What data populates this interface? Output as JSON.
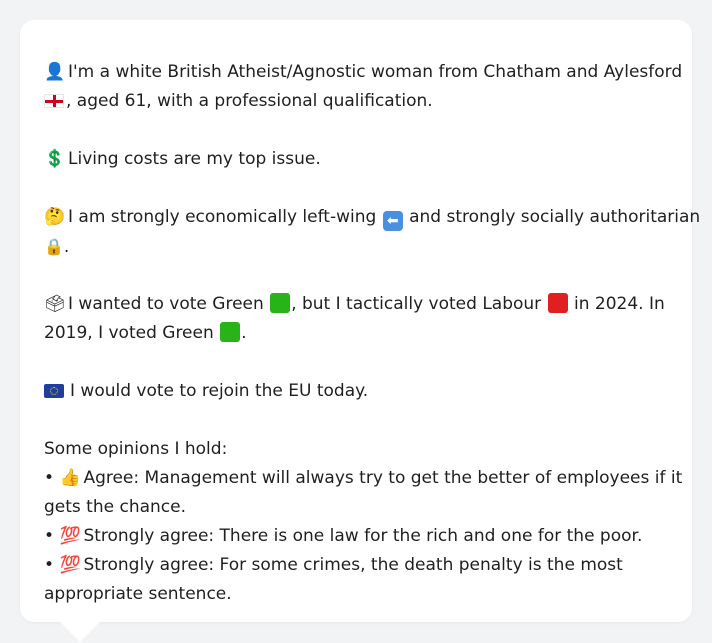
{
  "card": {
    "line1": "I'm a white British Atheist/Agnostic woman from Chatham and Aylesford",
    "line2": ", aged 61, with a professional qualification.",
    "line3": "Living costs are my top issue.",
    "line4_a": "I am strongly economically left-wing",
    "line4_b": "and strongly socially authoritarian",
    "line5": ".",
    "line6_a": "I wanted to vote Green",
    "line6_b": ", but I tactically voted Labour",
    "line6_c": "in 2024. In",
    "line7_a": "2019, I voted Green",
    "line7_b": ".",
    "line8": "I would vote to rejoin the EU today.",
    "opinions_header": "Some opinions I hold:",
    "op1_line1": "Agree: Management will always try to get the better of employees if it",
    "op1_line2": "gets the chance.",
    "op2_line1": "Strongly agree: There is one law for the rich and one for the poor.",
    "op3_line1": "Strongly agree: For some crimes, the death penalty is the most",
    "op3_line2": "appropriate sentence."
  },
  "icons": {
    "person": "bust-in-silhouette-icon",
    "flag": "england-flag-icon",
    "dollar": "dollar-icon",
    "thinking": "thinking-face-icon",
    "left_arrow": "left-arrow-icon",
    "lock": "lock-icon",
    "ballot": "ballot-box-icon",
    "green_square": "green-square-icon",
    "red_square": "red-square-icon",
    "eu_flag": "eu-flag-icon",
    "thumbs_up": "thumbs-up-icon",
    "hundred": "hundred-points-icon"
  },
  "colors": {
    "background": "#f2f3f5",
    "card": "#ffffff",
    "text": "#1f1f1f",
    "green": "#28b318",
    "red": "#e02020",
    "eu_blue": "#1f3f9b"
  }
}
